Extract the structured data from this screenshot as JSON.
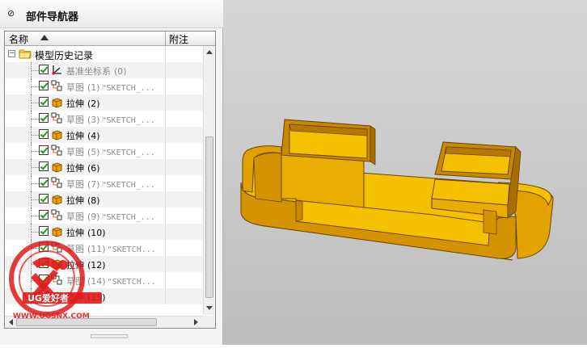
{
  "navigator": {
    "title": "部件导航器",
    "columns": {
      "name": "名称",
      "note": "附注"
    },
    "root": {
      "label": "模型历史记录",
      "expanded": true
    },
    "items": [
      {
        "label": "基准坐标系",
        "index": "(0)",
        "suffix": "",
        "type": "datum",
        "checked": true,
        "greyed": true
      },
      {
        "label": "草图",
        "index": "(1)",
        "suffix": "\"SKETCH_...",
        "type": "sketch",
        "checked": true,
        "greyed": true
      },
      {
        "label": "拉伸",
        "index": "(2)",
        "suffix": "",
        "type": "extrude",
        "checked": true,
        "greyed": false
      },
      {
        "label": "草图",
        "index": "(3)",
        "suffix": "\"SKETCH_...",
        "type": "sketch",
        "checked": true,
        "greyed": true
      },
      {
        "label": "拉伸",
        "index": "(4)",
        "suffix": "",
        "type": "extrude",
        "checked": true,
        "greyed": false
      },
      {
        "label": "草图",
        "index": "(5)",
        "suffix": "\"SKETCH_...",
        "type": "sketch",
        "checked": true,
        "greyed": true
      },
      {
        "label": "拉伸",
        "index": "(6)",
        "suffix": "",
        "type": "extrude",
        "checked": true,
        "greyed": false
      },
      {
        "label": "草图",
        "index": "(7)",
        "suffix": "\"SKETCH_...",
        "type": "sketch",
        "checked": true,
        "greyed": true
      },
      {
        "label": "拉伸",
        "index": "(8)",
        "suffix": "",
        "type": "extrude",
        "checked": true,
        "greyed": false
      },
      {
        "label": "草图",
        "index": "(9)",
        "suffix": "\"SKETCH_...",
        "type": "sketch",
        "checked": true,
        "greyed": true
      },
      {
        "label": "拉伸",
        "index": "(10)",
        "suffix": "",
        "type": "extrude",
        "checked": true,
        "greyed": false
      },
      {
        "label": "草图",
        "index": "(11)",
        "suffix": "\"SKETCH...",
        "type": "sketch",
        "checked": true,
        "greyed": true
      },
      {
        "label": "拉伸",
        "index": "(12)",
        "suffix": "",
        "type": "extrude",
        "checked": true,
        "greyed": false
      },
      {
        "label": "草图",
        "index": "(14)",
        "suffix": "\"SKETCH...",
        "type": "sketch",
        "checked": true,
        "greyed": true
      },
      {
        "label": "拉伸",
        "index": "(15)",
        "suffix": "",
        "type": "extrude",
        "checked": true,
        "greyed": false
      }
    ]
  },
  "watermark": {
    "brand": "UG爱好者",
    "url": "WWW.UGSNX.COM"
  },
  "colors": {
    "model_face": "#f5c000",
    "model_edge": "#6a4400",
    "model_side": "#c98a00",
    "viewport_bg": "#cacaca"
  }
}
